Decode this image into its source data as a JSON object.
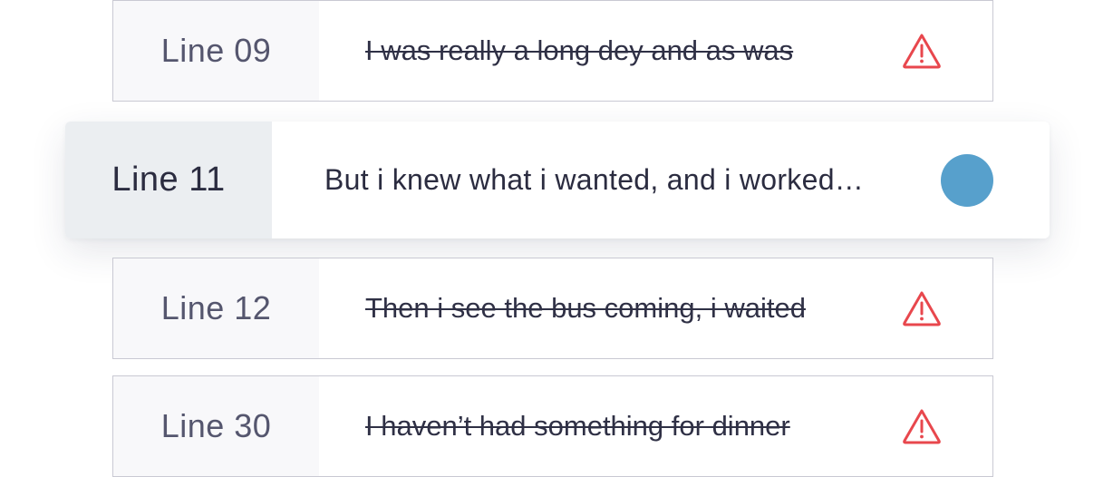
{
  "colors": {
    "warning": "#e8474d",
    "active_dot": "#57a0cc",
    "active_label_bg": "#ebeef1",
    "plain_label_bg": "#f8f8fa",
    "border": "#c9c9d3"
  },
  "rows": [
    {
      "label": "Line 09",
      "text": "I was really a long dey and as was",
      "status_icon": "warning-icon",
      "struck": true
    },
    {
      "label": "Line 11",
      "text": "But i knew what i wanted, and i worked…",
      "status_icon": "status-dot-icon",
      "struck": false,
      "active": true
    },
    {
      "label": "Line 12",
      "text": "Then i see the bus coming, i waited",
      "status_icon": "warning-icon",
      "struck": true
    },
    {
      "label": "Line 30",
      "text": "I haven’t had something for dinner",
      "status_icon": "warning-icon",
      "struck": true
    }
  ]
}
